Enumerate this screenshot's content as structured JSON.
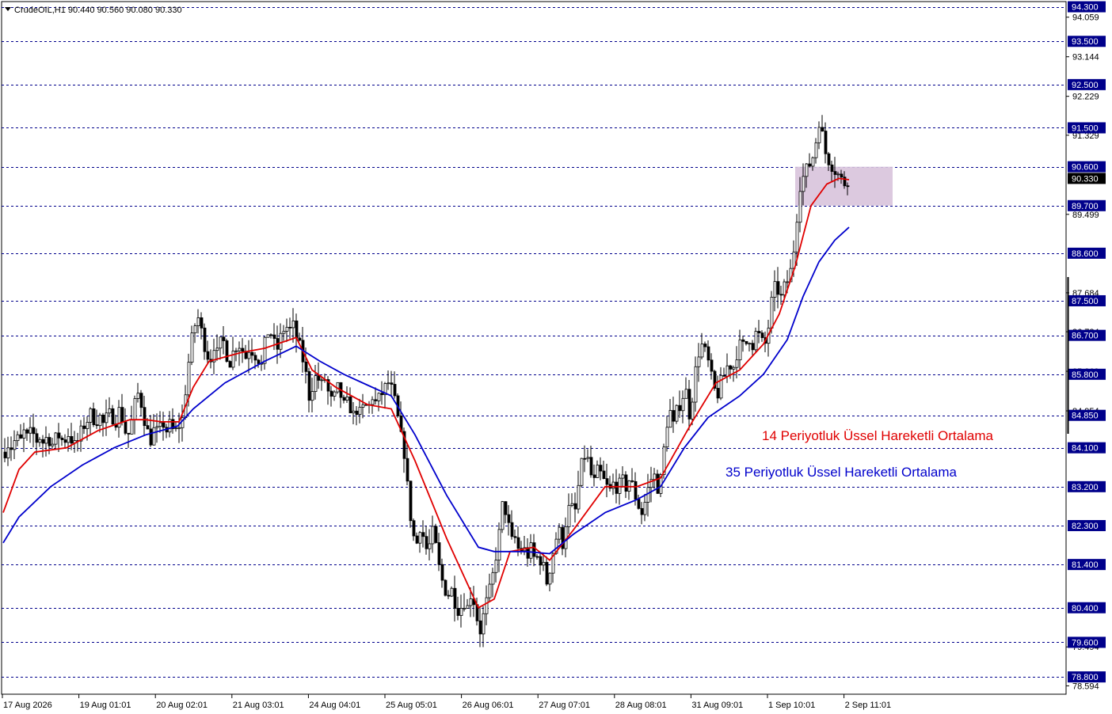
{
  "symbol_header": "CrudeOIL,H1  90.440 90.560 90.080 90.330",
  "annotations": {
    "ema14_label": "14 Periyotluk Üssel Hareketli Ortalama",
    "ema35_label": "35 Periyotluk Üssel Hareketli Ortalama"
  },
  "colors": {
    "background": "#ffffff",
    "grid_line": "#00008b",
    "level_label_bg": "#00008b",
    "level_label_text": "#ffffff",
    "current_price_bg": "#000000",
    "candles": "#000000",
    "ema14": "#e00000",
    "ema35": "#0000cc",
    "zone_fill": "#d8c3dc"
  },
  "icons": {
    "header_toggle": "triangle-down-icon"
  },
  "chart_data": {
    "type": "candlestick",
    "instrument": "CrudeOIL",
    "timeframe": "H1",
    "ohlc_current": {
      "open": 90.44,
      "high": 90.56,
      "low": 90.08,
      "close": 90.33
    },
    "current_price": "90.330",
    "ylim": [
      78.4,
      94.42
    ],
    "grid": true,
    "level_lines": [
      "94.300",
      "93.500",
      "92.500",
      "91.500",
      "90.600",
      "89.700",
      "88.600",
      "87.500",
      "86.700",
      "85.800",
      "84.850",
      "84.100",
      "83.200",
      "82.300",
      "81.400",
      "80.400",
      "79.600",
      "78.800"
    ],
    "y_ticks": [
      "94.059",
      "93.144",
      "92.229",
      "91.329",
      "89.499",
      "87.684",
      "86.784",
      "85.869",
      "84.954",
      "79.494",
      "78.594"
    ],
    "x_ticks": [
      "17 Aug 2026",
      "19 Aug 01:01",
      "20 Aug 02:01",
      "21 Aug 03:01",
      "24 Aug 04:01",
      "25 Aug 05:01",
      "26 Aug 06:01",
      "27 Aug 07:01",
      "28 Aug 08:01",
      "31 Aug 09:01",
      "1 Sep 10:01",
      "2 Sep 11:01"
    ],
    "zone": {
      "from": 89.7,
      "to": 90.6
    },
    "close_path": [
      [
        0,
        84.0
      ],
      [
        5,
        84.2
      ],
      [
        10,
        84.1
      ],
      [
        15,
        84.35
      ],
      [
        20,
        84.2
      ],
      [
        25,
        84.45
      ],
      [
        30,
        84.3
      ],
      [
        35,
        84.5
      ],
      [
        40,
        84.25
      ],
      [
        45,
        84.35
      ],
      [
        50,
        84.2
      ],
      [
        55,
        84.4
      ],
      [
        60,
        84.15
      ],
      [
        65,
        84.3
      ],
      [
        70,
        84.4
      ],
      [
        75,
        84.2
      ],
      [
        80,
        84.45
      ],
      [
        85,
        84.3
      ],
      [
        90,
        84.1
      ],
      [
        95,
        84.35
      ],
      [
        100,
        84.6
      ],
      [
        105,
        84.75
      ],
      [
        110,
        84.9
      ],
      [
        115,
        84.7
      ],
      [
        120,
        84.85
      ],
      [
        125,
        84.65
      ],
      [
        130,
        84.8
      ],
      [
        135,
        84.9
      ],
      [
        140,
        84.7
      ],
      [
        145,
        84.95
      ],
      [
        150,
        84.75
      ],
      [
        155,
        84.3
      ],
      [
        160,
        84.6
      ],
      [
        165,
        85.1
      ],
      [
        170,
        85.4
      ],
      [
        175,
        84.95
      ],
      [
        180,
        84.5
      ],
      [
        185,
        84.3
      ],
      [
        190,
        84.55
      ],
      [
        195,
        84.4
      ],
      [
        200,
        84.7
      ],
      [
        205,
        84.5
      ],
      [
        210,
        84.65
      ],
      [
        215,
        84.4
      ],
      [
        220,
        84.6
      ],
      [
        225,
        84.75
      ],
      [
        230,
        85.6
      ],
      [
        235,
        86.4
      ],
      [
        240,
        86.9
      ],
      [
        245,
        87.1
      ],
      [
        250,
        86.7
      ],
      [
        255,
        86.35
      ],
      [
        260,
        86.1
      ],
      [
        265,
        86.5
      ],
      [
        270,
        86.2
      ],
      [
        275,
        86.7
      ],
      [
        280,
        86.3
      ],
      [
        285,
        86.1
      ],
      [
        290,
        86.35
      ],
      [
        295,
        86.55
      ],
      [
        300,
        86.4
      ],
      [
        305,
        86.2
      ],
      [
        310,
        86.45
      ],
      [
        315,
        86.3
      ],
      [
        320,
        86.2
      ],
      [
        325,
        86.0
      ],
      [
        330,
        86.6
      ],
      [
        335,
        86.9
      ],
      [
        340,
        86.5
      ],
      [
        345,
        86.4
      ],
      [
        350,
        86.7
      ],
      [
        355,
        86.95
      ],
      [
        360,
        86.8
      ],
      [
        365,
        86.9
      ],
      [
        370,
        86.6
      ],
      [
        375,
        86.3
      ],
      [
        380,
        85.9
      ],
      [
        385,
        85.3
      ],
      [
        390,
        85.6
      ],
      [
        395,
        85.8
      ],
      [
        400,
        85.5
      ],
      [
        405,
        85.7
      ],
      [
        410,
        85.3
      ],
      [
        415,
        85.1
      ],
      [
        420,
        85.5
      ],
      [
        425,
        85.3
      ],
      [
        430,
        85.0
      ],
      [
        435,
        85.2
      ],
      [
        440,
        84.8
      ],
      [
        445,
        85.0
      ],
      [
        450,
        84.85
      ],
      [
        455,
        85.1
      ],
      [
        460,
        85.0
      ],
      [
        465,
        85.3
      ],
      [
        470,
        85.1
      ],
      [
        475,
        85.3
      ],
      [
        480,
        85.45
      ],
      [
        485,
        85.6
      ],
      [
        490,
        85.4
      ],
      [
        495,
        85.0
      ],
      [
        500,
        84.4
      ],
      [
        505,
        84.0
      ],
      [
        510,
        83.0
      ],
      [
        515,
        82.2
      ],
      [
        520,
        81.8
      ],
      [
        525,
        82.3
      ],
      [
        530,
        82.0
      ],
      [
        535,
        81.6
      ],
      [
        540,
        82.2
      ],
      [
        545,
        81.8
      ],
      [
        550,
        81.2
      ],
      [
        555,
        80.9
      ],
      [
        560,
        80.7
      ],
      [
        565,
        80.8
      ],
      [
        570,
        80.5
      ],
      [
        575,
        80.3
      ],
      [
        580,
        80.6
      ],
      [
        585,
        80.4
      ],
      [
        590,
        80.8
      ],
      [
        595,
        80.4
      ],
      [
        600,
        79.8
      ],
      [
        605,
        80.2
      ],
      [
        610,
        80.6
      ],
      [
        615,
        80.9
      ],
      [
        620,
        81.5
      ],
      [
        625,
        82.1
      ],
      [
        630,
        82.9
      ],
      [
        635,
        82.5
      ],
      [
        640,
        81.9
      ],
      [
        645,
        82.0
      ],
      [
        650,
        81.7
      ],
      [
        655,
        81.8
      ],
      [
        660,
        81.6
      ],
      [
        665,
        81.75
      ],
      [
        670,
        81.5
      ],
      [
        675,
        81.6
      ],
      [
        680,
        81.4
      ],
      [
        685,
        81.0
      ],
      [
        690,
        81.4
      ],
      [
        695,
        81.9
      ],
      [
        700,
        82.2
      ],
      [
        705,
        81.9
      ],
      [
        710,
        82.5
      ],
      [
        715,
        82.8
      ],
      [
        720,
        82.5
      ],
      [
        725,
        83.2
      ],
      [
        730,
        83.8
      ],
      [
        735,
        84.0
      ],
      [
        740,
        83.5
      ],
      [
        745,
        83.3
      ],
      [
        750,
        83.6
      ],
      [
        755,
        83.4
      ],
      [
        760,
        83.2
      ],
      [
        765,
        83.1
      ],
      [
        770,
        83.3
      ],
      [
        775,
        83.15
      ],
      [
        780,
        83.35
      ],
      [
        785,
        83.2
      ],
      [
        790,
        83.4
      ],
      [
        795,
        83.1
      ],
      [
        800,
        82.8
      ],
      [
        805,
        82.6
      ],
      [
        810,
        82.9
      ],
      [
        815,
        83.3
      ],
      [
        820,
        83.5
      ],
      [
        825,
        83.2
      ],
      [
        830,
        83.4
      ],
      [
        835,
        84.5
      ],
      [
        840,
        85.0
      ],
      [
        845,
        84.6
      ],
      [
        850,
        85.0
      ],
      [
        855,
        85.2
      ],
      [
        860,
        85.5
      ],
      [
        865,
        84.9
      ],
      [
        870,
        85.4
      ],
      [
        875,
        86.2
      ],
      [
        880,
        86.5
      ],
      [
        885,
        86.3
      ],
      [
        890,
        86.0
      ],
      [
        895,
        85.5
      ],
      [
        900,
        85.3
      ],
      [
        905,
        85.6
      ],
      [
        910,
        85.8
      ],
      [
        915,
        86.1
      ],
      [
        920,
        85.9
      ],
      [
        925,
        86.3
      ],
      [
        930,
        86.5
      ],
      [
        935,
        86.4
      ],
      [
        940,
        86.7
      ],
      [
        945,
        86.5
      ],
      [
        950,
        86.8
      ],
      [
        955,
        86.6
      ],
      [
        960,
        86.4
      ],
      [
        965,
        86.9
      ],
      [
        970,
        87.6
      ],
      [
        975,
        87.9
      ],
      [
        980,
        87.5
      ],
      [
        985,
        87.8
      ],
      [
        990,
        88.0
      ],
      [
        995,
        88.3
      ],
      [
        1000,
        89.3
      ],
      [
        1005,
        90.2
      ],
      [
        1010,
        90.4
      ],
      [
        1015,
        90.6
      ],
      [
        1020,
        90.75
      ],
      [
        1025,
        91.2
      ],
      [
        1030,
        91.8
      ],
      [
        1035,
        91.0
      ],
      [
        1040,
        90.8
      ],
      [
        1045,
        90.65
      ],
      [
        1050,
        90.5
      ],
      [
        1055,
        90.35
      ],
      [
        1060,
        90.2
      ],
      [
        1065,
        90.33
      ]
    ],
    "series": [
      {
        "name": "14 Periyotluk Üssel Hareketli Ortalama",
        "path": [
          [
            0,
            82.6
          ],
          [
            20,
            83.6
          ],
          [
            40,
            84.0
          ],
          [
            80,
            84.1
          ],
          [
            120,
            84.5
          ],
          [
            160,
            84.75
          ],
          [
            180,
            84.75
          ],
          [
            200,
            84.7
          ],
          [
            222,
            84.7
          ],
          [
            240,
            85.5
          ],
          [
            260,
            86.1
          ],
          [
            300,
            86.3
          ],
          [
            330,
            86.4
          ],
          [
            370,
            86.65
          ],
          [
            390,
            85.9
          ],
          [
            420,
            85.5
          ],
          [
            460,
            85.1
          ],
          [
            490,
            85.0
          ],
          [
            520,
            83.8
          ],
          [
            560,
            82.0
          ],
          [
            600,
            80.4
          ],
          [
            620,
            80.6
          ],
          [
            640,
            81.7
          ],
          [
            670,
            81.8
          ],
          [
            690,
            81.5
          ],
          [
            720,
            82.2
          ],
          [
            760,
            83.2
          ],
          [
            800,
            83.2
          ],
          [
            830,
            83.4
          ],
          [
            870,
            84.7
          ],
          [
            900,
            85.6
          ],
          [
            930,
            85.9
          ],
          [
            960,
            86.5
          ],
          [
            980,
            87.2
          ],
          [
            1000,
            88.3
          ],
          [
            1020,
            89.7
          ],
          [
            1040,
            90.2
          ],
          [
            1055,
            90.33
          ],
          [
            1068,
            90.3
          ]
        ]
      },
      {
        "name": "35 Periyotluk Üssel Hareketli Ortalama",
        "path": [
          [
            0,
            81.9
          ],
          [
            20,
            82.5
          ],
          [
            60,
            83.2
          ],
          [
            100,
            83.7
          ],
          [
            140,
            84.1
          ],
          [
            180,
            84.4
          ],
          [
            220,
            84.6
          ],
          [
            240,
            85.0
          ],
          [
            280,
            85.6
          ],
          [
            330,
            86.1
          ],
          [
            370,
            86.45
          ],
          [
            400,
            86.1
          ],
          [
            430,
            85.8
          ],
          [
            460,
            85.55
          ],
          [
            490,
            85.3
          ],
          [
            520,
            84.4
          ],
          [
            560,
            83.0
          ],
          [
            600,
            81.8
          ],
          [
            620,
            81.7
          ],
          [
            660,
            81.7
          ],
          [
            690,
            81.65
          ],
          [
            720,
            82.1
          ],
          [
            760,
            82.6
          ],
          [
            800,
            82.9
          ],
          [
            830,
            83.2
          ],
          [
            860,
            84.1
          ],
          [
            890,
            84.8
          ],
          [
            930,
            85.3
          ],
          [
            960,
            85.8
          ],
          [
            990,
            86.6
          ],
          [
            1010,
            87.6
          ],
          [
            1030,
            88.4
          ],
          [
            1050,
            88.9
          ],
          [
            1068,
            89.2
          ]
        ]
      }
    ]
  }
}
